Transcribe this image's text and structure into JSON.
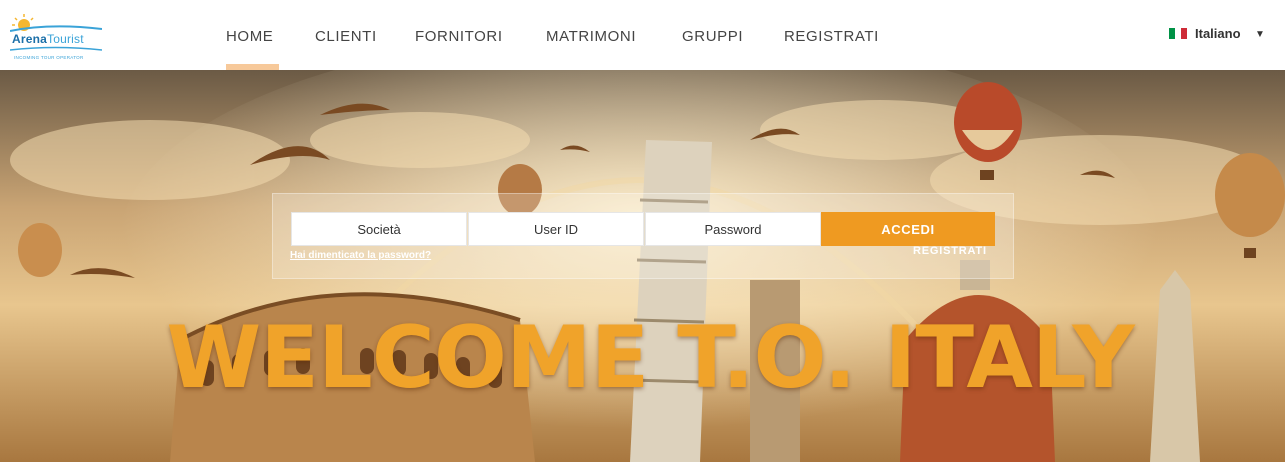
{
  "header": {
    "logo": {
      "brand_first": "Arena",
      "brand_second": "Tourist",
      "tagline": "INCOMING TOUR OPERATOR",
      "icon": "sun-waves-logo"
    },
    "nav": [
      {
        "label": "HOME",
        "active": true
      },
      {
        "label": "CLIENTI",
        "active": false
      },
      {
        "label": "FORNITORI",
        "active": false
      },
      {
        "label": "MATRIMONI",
        "active": false
      },
      {
        "label": "GRUPPI",
        "active": false
      },
      {
        "label": "REGISTRATI",
        "active": false
      }
    ],
    "language": {
      "label": "Italiano",
      "flag_icon": "italy-flag-icon",
      "caret_icon": "caret-down-icon",
      "flag_colors": [
        "#009246",
        "#ffffff",
        "#ce2b37"
      ]
    },
    "active_indicator_color": "#f7c99a"
  },
  "login": {
    "societa_placeholder": "Società",
    "userid_placeholder": "User ID",
    "password_placeholder": "Password",
    "submit_label": "ACCEDI",
    "forgot_label": "Hai dimenticato la password?",
    "register_label": "REGISTRATI",
    "accent_color": "#ef9a21"
  },
  "hero": {
    "headline": "WELCOME T.O. ITALY",
    "headline_color": "#f0a32a"
  }
}
